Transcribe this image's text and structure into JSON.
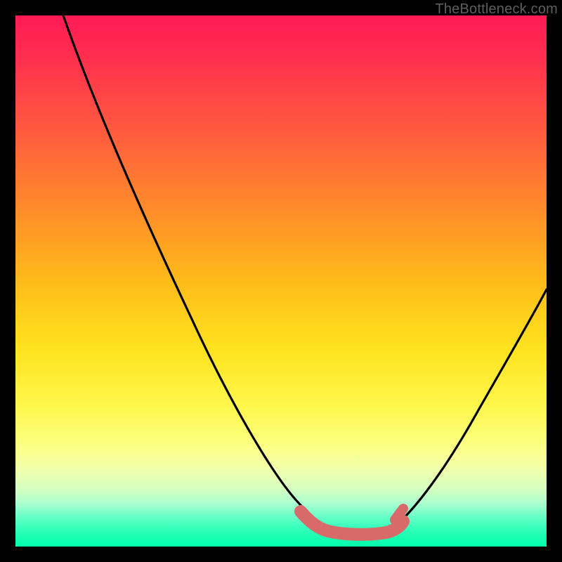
{
  "watermark": "TheBottleneck.com",
  "colors": {
    "background": "#000000",
    "curve": "#000000",
    "marker": "#d96a6a",
    "gradient_top": "#ff1a55",
    "gradient_bottom": "#00ffab"
  },
  "chart_data": {
    "type": "line",
    "title": "",
    "xlabel": "",
    "ylabel": "",
    "xlim": [
      0,
      100
    ],
    "ylim": [
      0,
      100
    ],
    "grid": false,
    "legend": "none",
    "series": [
      {
        "name": "left-branch",
        "x": [
          9,
          15,
          20,
          25,
          30,
          35,
          40,
          45,
          50,
          53,
          55,
          57
        ],
        "y": [
          99,
          88,
          78,
          69,
          59,
          50,
          40,
          31,
          21,
          14,
          10,
          5
        ]
      },
      {
        "name": "right-branch",
        "x": [
          72,
          75,
          80,
          85,
          90,
          95,
          100
        ],
        "y": [
          5,
          10,
          18,
          27,
          36,
          45,
          54
        ]
      },
      {
        "name": "valley-marker",
        "x": [
          55,
          57,
          59,
          61,
          63,
          65,
          67,
          69,
          71,
          72
        ],
        "y": [
          6,
          4,
          3,
          3,
          3,
          3,
          3,
          3,
          4,
          6
        ]
      }
    ],
    "annotations": [
      {
        "text": "TheBottleneck.com",
        "position": "top-right"
      }
    ]
  }
}
